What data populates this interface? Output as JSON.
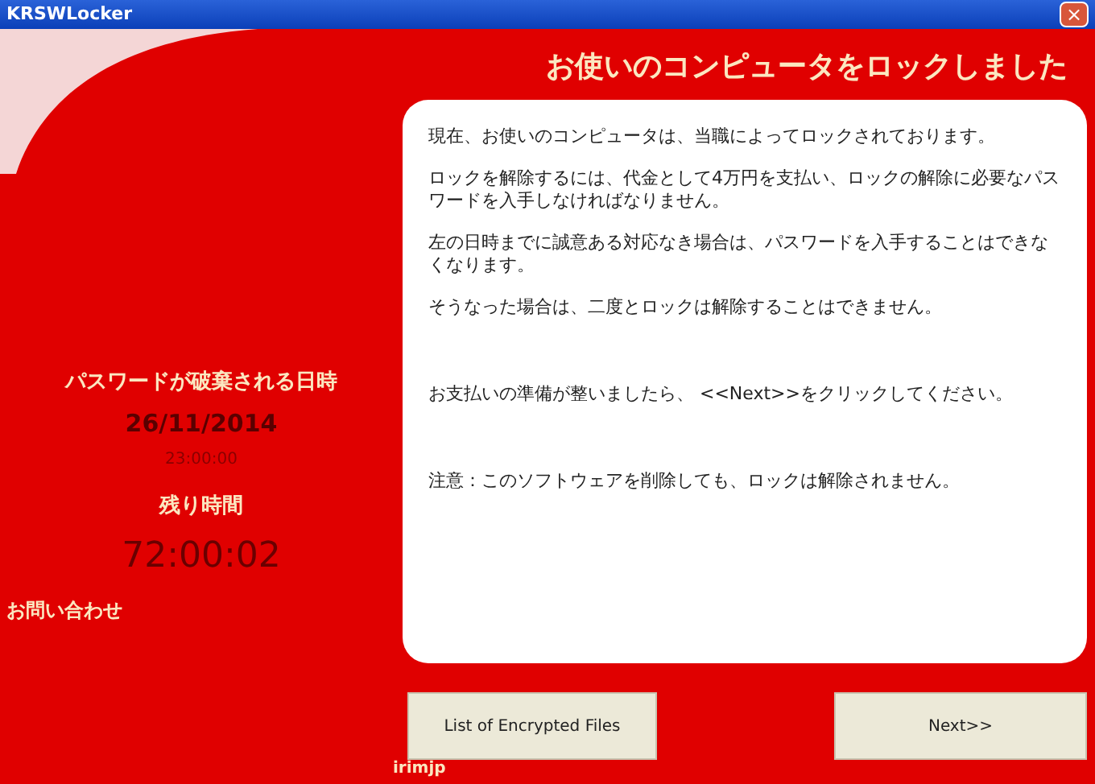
{
  "window": {
    "title": "KRSWLocker",
    "close": "×"
  },
  "heading": "お使いのコンピュータをロックしました",
  "left_panel": {
    "deadline_label": "パスワードが破棄される日時",
    "deadline_date": "26/11/2014",
    "deadline_time": "23:00:00",
    "remaining_label": "残り時間",
    "remaining_time": "72:00:02",
    "contact_label": "お問い合わせ",
    "contact_fragment": "irimjp"
  },
  "message": [
    "現在、お使いのコンピュータは、当職によってロックされております。",
    "ロックを解除するには、代金として4万円を支払い、ロックの解除に必要なパスワードを入手しなければなりません。",
    "左の日時までに誠意ある対応なき場合は、パスワードを入手することはできなくなります。",
    "そうなった場合は、二度とロックは解除することはできません。",
    "お支払いの準備が整いましたら、 <<Next>>をクリックしてください。",
    "注意：このソフトウェアを削除しても、ロックは解除されません。"
  ],
  "buttons": [
    "List of Encrypted Files",
    "Next>>"
  ]
}
